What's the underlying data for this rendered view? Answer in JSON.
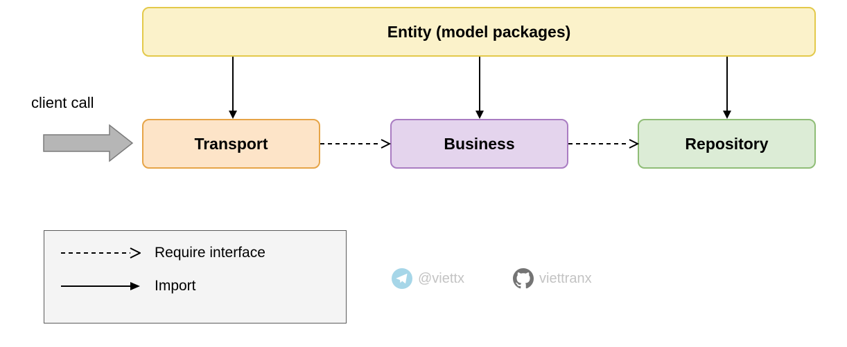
{
  "entity": {
    "label": "Entity (model packages)"
  },
  "transport": {
    "label": "Transport"
  },
  "business": {
    "label": "Business"
  },
  "repository": {
    "label": "Repository"
  },
  "clientCall": {
    "label": "client call"
  },
  "legend": {
    "require": "Require interface",
    "import": "Import"
  },
  "social": {
    "telegram": "@viettx",
    "github": "viettranx"
  }
}
